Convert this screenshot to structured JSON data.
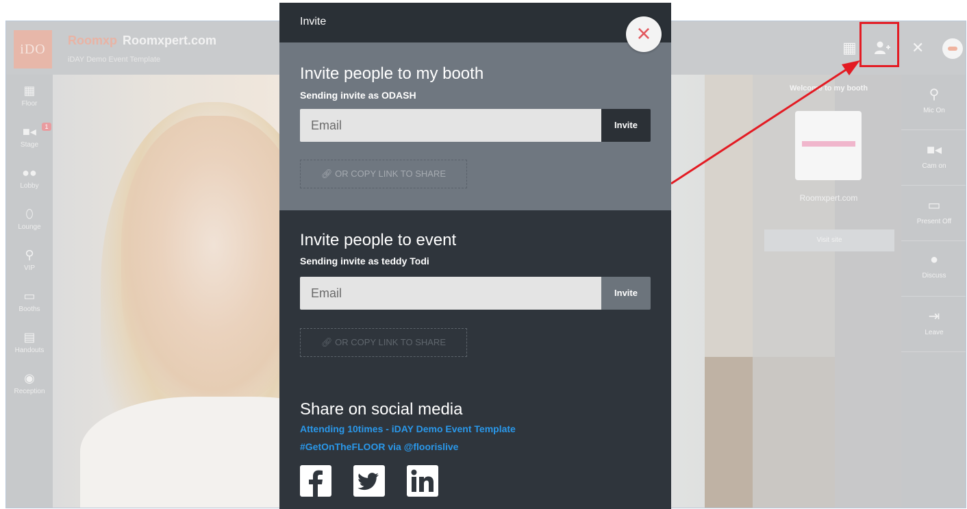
{
  "header": {
    "prefix": "Roomxp",
    "title": "Roomxpert.com",
    "subtitle": "iDAY Demo Event Template",
    "logo_text": "iDO"
  },
  "left_nav": [
    {
      "label": "Floor",
      "icon": "map-icon"
    },
    {
      "label": "Stage",
      "icon": "video-icon",
      "badge": "1"
    },
    {
      "label": "Lobby",
      "icon": "people-icon"
    },
    {
      "label": "Lounge",
      "icon": "handshake-icon"
    },
    {
      "label": "VIP",
      "icon": "mic-icon"
    },
    {
      "label": "Booths",
      "icon": "store-icon"
    },
    {
      "label": "Handouts",
      "icon": "document-icon"
    },
    {
      "label": "Reception",
      "icon": "robot-icon"
    }
  ],
  "booth_panel": {
    "welcome": "Welcome to my booth",
    "name": "Roomxpert.com",
    "visit_button": "Visit site"
  },
  "right_bar": [
    {
      "label": "Mic On",
      "icon": "mic-icon"
    },
    {
      "label": "Cam on",
      "icon": "camera-icon"
    },
    {
      "label": "Present Off",
      "icon": "monitor-icon"
    },
    {
      "label": "Discuss",
      "icon": "chat-icon"
    },
    {
      "label": "Leave",
      "icon": "exit-icon"
    }
  ],
  "modal": {
    "title": "Invite",
    "booth": {
      "heading": "Invite people to my booth",
      "subheading": "Sending invite as ODASH",
      "email_placeholder": "Email",
      "invite_label": "Invite",
      "copy_link": "OR COPY LINK TO SHARE"
    },
    "event": {
      "heading": "Invite people to event",
      "subheading": "Sending invite as teddy Todi",
      "email_placeholder": "Email",
      "invite_label": "Invite",
      "copy_link": "OR COPY LINK TO SHARE"
    },
    "social": {
      "heading": "Share on social media",
      "line1": "Attending 10times - iDAY Demo Event Template",
      "line2": "#GetOnTheFLOOR via @floorislive",
      "icons": [
        "facebook-icon",
        "twitter-icon",
        "linkedin-icon"
      ]
    }
  },
  "colors": {
    "highlight": "#e31b23",
    "modal_bg": "#2f353c",
    "booth_section_bg": "#6f7780",
    "booth_invite_btn": "#2b3036",
    "event_invite_btn": "#6c747c",
    "link": "#2a98ea",
    "close_x": "#e2585e"
  }
}
